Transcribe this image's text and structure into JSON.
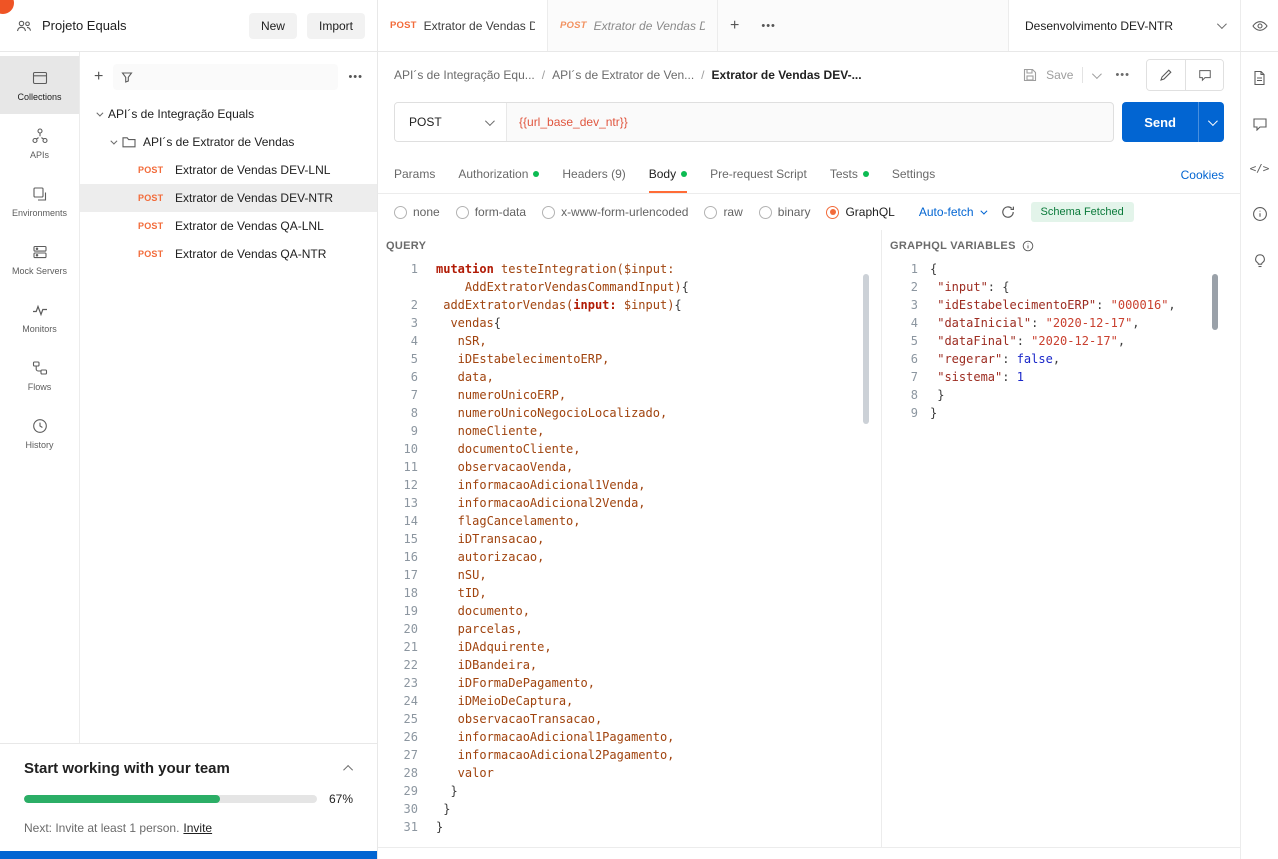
{
  "app": {
    "workspace": "Projeto Equals",
    "new_button": "New",
    "import_button": "Import",
    "environment": "Desenvolvimento DEV-NTR"
  },
  "icons": {
    "plus": "+",
    "more_horizontal": "•••",
    "code": "</>"
  },
  "tabs": {
    "tab1_method": "POST",
    "tab1_title": "Extrator de Vendas DEV",
    "tab2_method": "POST",
    "tab2_title": "Extrator de Vendas DEV"
  },
  "rail": {
    "items": [
      {
        "label": "Collections"
      },
      {
        "label": "APIs"
      },
      {
        "label": "Environments"
      },
      {
        "label": "Mock Servers"
      },
      {
        "label": "Monitors"
      },
      {
        "label": "Flows"
      },
      {
        "label": "History"
      }
    ]
  },
  "sidebar": {
    "root": "API´s de Integração Equals",
    "folder": "API´s de Extrator de Vendas",
    "requests": [
      {
        "method": "POST",
        "name": "Extrator de Vendas DEV-LNL"
      },
      {
        "method": "POST",
        "name": "Extrator de Vendas DEV-NTR"
      },
      {
        "method": "POST",
        "name": "Extrator de Vendas QA-LNL"
      },
      {
        "method": "POST",
        "name": "Extrator de Vendas QA-NTR"
      }
    ]
  },
  "breadcrumb": {
    "items": [
      "API´s de Integração Equ...",
      "API´s de Extrator de Ven...",
      "Extrator de Vendas DEV-..."
    ]
  },
  "toolbar": {
    "save_label": "Save"
  },
  "request": {
    "method": "POST",
    "url": "{{url_base_dev_ntr}}",
    "send_label": "Send"
  },
  "request_tabs": {
    "params": "Params",
    "authorization": "Authorization",
    "headers": "Headers (9)",
    "body": "Body",
    "prerequest": "Pre-request Script",
    "tests": "Tests",
    "settings": "Settings",
    "cookies": "Cookies"
  },
  "body_options": {
    "options": [
      "none",
      "form-data",
      "x-www-form-urlencoded",
      "raw",
      "binary",
      "GraphQL"
    ],
    "selected": "GraphQL",
    "autofetch": "Auto-fetch",
    "schema_badge": "Schema Fetched"
  },
  "editor": {
    "query_header": "QUERY",
    "variables_header": "GRAPHQL VARIABLES",
    "query": {
      "lines": [
        {
          "n": "1",
          "ind": 0,
          "p": [
            {
              "c": "kw",
              "t": "mutation"
            },
            {
              "c": "id",
              "t": " testeIntegration("
            },
            {
              "c": "id",
              "t": "$input:"
            }
          ]
        },
        {
          "n": "",
          "ind": 4,
          "p": [
            {
              "c": "id",
              "t": "AddExtratorVendasCommandInput)"
            },
            {
              "c": "pu",
              "t": "{"
            }
          ]
        },
        {
          "n": "2",
          "ind": 1,
          "p": [
            {
              "c": "id",
              "t": "addExtratorVendas("
            },
            {
              "c": "kw",
              "t": "input:"
            },
            {
              "c": "id",
              "t": " $input)"
            },
            {
              "c": "pu",
              "t": "{"
            }
          ]
        },
        {
          "n": "3",
          "ind": 2,
          "p": [
            {
              "c": "id",
              "t": "vendas"
            },
            {
              "c": "pu",
              "t": "{"
            }
          ]
        },
        {
          "n": "4",
          "ind": 3,
          "p": [
            {
              "c": "id",
              "t": "nSR,"
            }
          ]
        },
        {
          "n": "5",
          "ind": 3,
          "p": [
            {
              "c": "id",
              "t": "iDEstabelecimentoERP,"
            }
          ]
        },
        {
          "n": "6",
          "ind": 3,
          "p": [
            {
              "c": "id",
              "t": "data,"
            }
          ]
        },
        {
          "n": "7",
          "ind": 3,
          "p": [
            {
              "c": "id",
              "t": "numeroUnicoERP,"
            }
          ]
        },
        {
          "n": "8",
          "ind": 3,
          "p": [
            {
              "c": "id",
              "t": "numeroUnicoNegocioLocalizado,"
            }
          ]
        },
        {
          "n": "9",
          "ind": 3,
          "p": [
            {
              "c": "id",
              "t": "nomeCliente,"
            }
          ]
        },
        {
          "n": "10",
          "ind": 3,
          "p": [
            {
              "c": "id",
              "t": "documentoCliente,"
            }
          ]
        },
        {
          "n": "11",
          "ind": 3,
          "p": [
            {
              "c": "id",
              "t": "observacaoVenda,"
            }
          ]
        },
        {
          "n": "12",
          "ind": 3,
          "p": [
            {
              "c": "id",
              "t": "informacaoAdicional1Venda,"
            }
          ]
        },
        {
          "n": "13",
          "ind": 3,
          "p": [
            {
              "c": "id",
              "t": "informacaoAdicional2Venda,"
            }
          ]
        },
        {
          "n": "14",
          "ind": 3,
          "p": [
            {
              "c": "id",
              "t": "flagCancelamento,"
            }
          ]
        },
        {
          "n": "15",
          "ind": 3,
          "p": [
            {
              "c": "id",
              "t": "iDTransacao,"
            }
          ]
        },
        {
          "n": "16",
          "ind": 3,
          "p": [
            {
              "c": "id",
              "t": "autorizacao,"
            }
          ]
        },
        {
          "n": "17",
          "ind": 3,
          "p": [
            {
              "c": "id",
              "t": "nSU,"
            }
          ]
        },
        {
          "n": "18",
          "ind": 3,
          "p": [
            {
              "c": "id",
              "t": "tID,"
            }
          ]
        },
        {
          "n": "19",
          "ind": 3,
          "p": [
            {
              "c": "id",
              "t": "documento,"
            }
          ]
        },
        {
          "n": "20",
          "ind": 3,
          "p": [
            {
              "c": "id",
              "t": "parcelas,"
            }
          ]
        },
        {
          "n": "21",
          "ind": 3,
          "p": [
            {
              "c": "id",
              "t": "iDAdquirente,"
            }
          ]
        },
        {
          "n": "22",
          "ind": 3,
          "p": [
            {
              "c": "id",
              "t": "iDBandeira,"
            }
          ]
        },
        {
          "n": "23",
          "ind": 3,
          "p": [
            {
              "c": "id",
              "t": "iDFormaDePagamento,"
            }
          ]
        },
        {
          "n": "24",
          "ind": 3,
          "p": [
            {
              "c": "id",
              "t": "iDMeioDeCaptura,"
            }
          ]
        },
        {
          "n": "25",
          "ind": 3,
          "p": [
            {
              "c": "id",
              "t": "observacaoTransacao,"
            }
          ]
        },
        {
          "n": "26",
          "ind": 3,
          "p": [
            {
              "c": "id",
              "t": "informacaoAdicional1Pagamento,"
            }
          ]
        },
        {
          "n": "27",
          "ind": 3,
          "p": [
            {
              "c": "id",
              "t": "informacaoAdicional2Pagamento,"
            }
          ]
        },
        {
          "n": "28",
          "ind": 3,
          "p": [
            {
              "c": "id",
              "t": "valor"
            }
          ]
        },
        {
          "n": "29",
          "ind": 2,
          "p": [
            {
              "c": "pu",
              "t": "}"
            }
          ]
        },
        {
          "n": "30",
          "ind": 1,
          "p": [
            {
              "c": "pu",
              "t": "}"
            }
          ]
        },
        {
          "n": "31",
          "ind": 0,
          "p": [
            {
              "c": "pu",
              "t": "}"
            }
          ]
        }
      ]
    },
    "variables": {
      "lines": [
        {
          "n": "1",
          "ind": 0,
          "p": [
            {
              "c": "pu",
              "t": "{"
            }
          ]
        },
        {
          "n": "2",
          "ind": 1,
          "p": [
            {
              "c": "key",
              "t": "\"input\""
            },
            {
              "c": "pu",
              "t": ": {"
            }
          ]
        },
        {
          "n": "3",
          "ind": 1,
          "p": [
            {
              "c": "key",
              "t": "\"idEstabelecimentoERP\""
            },
            {
              "c": "pu",
              "t": ": "
            },
            {
              "c": "str",
              "t": "\"000016\""
            },
            {
              "c": "pu",
              "t": ","
            }
          ]
        },
        {
          "n": "4",
          "ind": 1,
          "p": [
            {
              "c": "key",
              "t": "\"dataInicial\""
            },
            {
              "c": "pu",
              "t": ": "
            },
            {
              "c": "str",
              "t": "\"2020-12-17\""
            },
            {
              "c": "pu",
              "t": ","
            }
          ]
        },
        {
          "n": "5",
          "ind": 1,
          "p": [
            {
              "c": "key",
              "t": "\"dataFinal\""
            },
            {
              "c": "pu",
              "t": ": "
            },
            {
              "c": "str",
              "t": "\"2020-12-17\""
            },
            {
              "c": "pu",
              "t": ","
            }
          ]
        },
        {
          "n": "6",
          "ind": 1,
          "p": [
            {
              "c": "key",
              "t": "\"regerar\""
            },
            {
              "c": "pu",
              "t": ": "
            },
            {
              "c": "bool",
              "t": "false"
            },
            {
              "c": "pu",
              "t": ","
            }
          ]
        },
        {
          "n": "7",
          "ind": 1,
          "p": [
            {
              "c": "key",
              "t": "\"sistema\""
            },
            {
              "c": "pu",
              "t": ": "
            },
            {
              "c": "num",
              "t": "1"
            }
          ]
        },
        {
          "n": "8",
          "ind": 1,
          "p": [
            {
              "c": "pu",
              "t": "}"
            }
          ]
        },
        {
          "n": "9",
          "ind": 0,
          "p": [
            {
              "c": "pu",
              "t": "}"
            }
          ]
        }
      ]
    }
  },
  "team_card": {
    "title": "Start working with your team",
    "progress_percent": "67%",
    "progress_value": 67,
    "next_text": "Next: Invite at least 1 person.",
    "invite_link": "Invite"
  },
  "colors": {
    "method_orange": "#f26b3a",
    "accent_orange": "#ff6c37",
    "send_blue": "#0265d2",
    "success_green": "#0cbb52",
    "progress_green": "#2bae66",
    "schema_badge_bg": "#e3f4ea",
    "schema_badge_text": "#0a7a3a",
    "url_variable": "#e0563f"
  }
}
